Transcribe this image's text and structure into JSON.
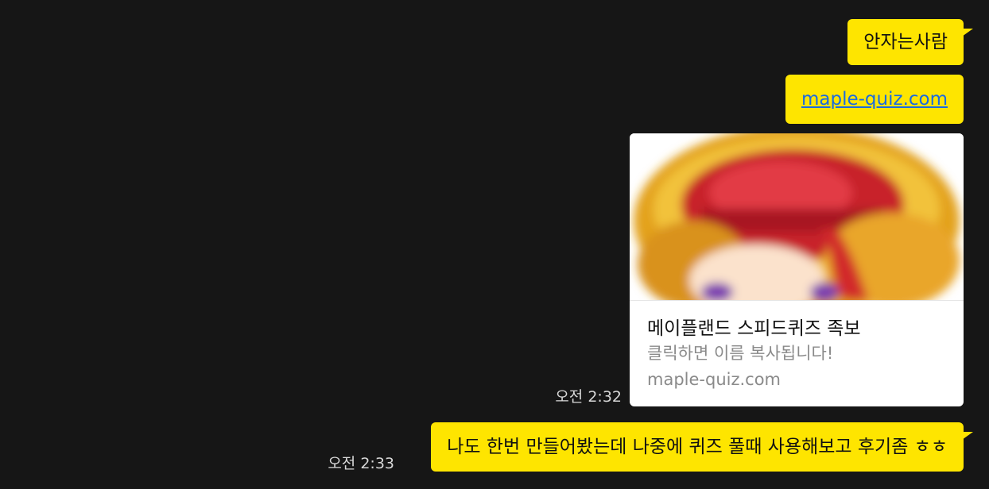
{
  "colors": {
    "background": "#161616",
    "bubble": "#fee500",
    "link": "#1a6be0",
    "card": "#ffffff",
    "muted_text": "#8a8a8a",
    "timestamp": "#d8d8d8"
  },
  "messages": [
    {
      "text": "안자는사람"
    },
    {
      "text": "maple-quiz.com"
    },
    {
      "card": {
        "image_icon": "character-thumbnail-icon",
        "title": "메이플랜드 스피드퀴즈 족보",
        "description": "클릭하면 이름 복사됩니다!",
        "domain": "maple-quiz.com"
      },
      "time": "오전 2:32"
    },
    {
      "text": "나도 한번 만들어봤는데 나중에 퀴즈 풀때 사용해보고 후기좀 ㅎㅎ",
      "time": "오전 2:33"
    }
  ]
}
